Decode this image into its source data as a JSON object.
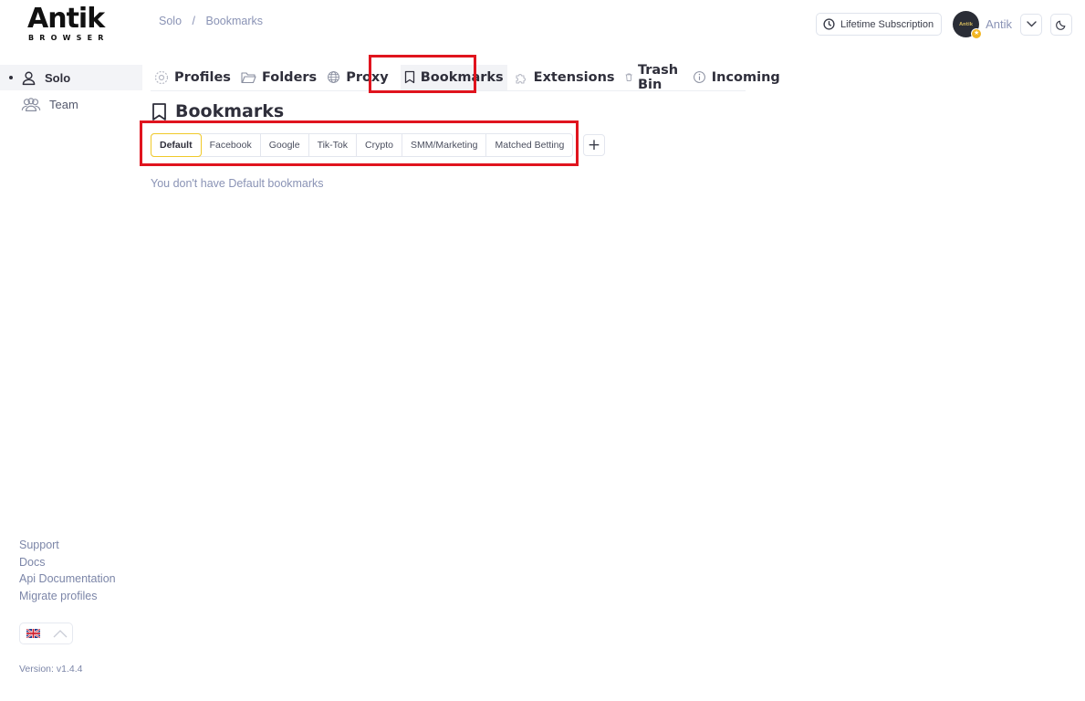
{
  "logo": {
    "main": "Antik",
    "sub": "BROWSER"
  },
  "breadcrumb": {
    "items": [
      "Solo",
      "Bookmarks"
    ],
    "separator": "/"
  },
  "header": {
    "subscription_label": "Lifetime Subscription",
    "username": "Antik",
    "avatar_text": "Antik"
  },
  "sidebar": {
    "items": [
      {
        "label": "Solo",
        "icon": "user-icon",
        "active": true
      },
      {
        "label": "Team",
        "icon": "users-icon",
        "active": false
      }
    ],
    "links": [
      "Support",
      "Docs",
      "Api Documentation",
      "Migrate profiles"
    ],
    "language": "English (UK)",
    "version": "Version: v1.4.4"
  },
  "nav": {
    "tabs": [
      {
        "label": "Profiles",
        "icon": "fingerprint-icon"
      },
      {
        "label": "Folders",
        "icon": "folder-icon"
      },
      {
        "label": "Proxy",
        "icon": "globe-icon"
      },
      {
        "label": "Bookmarks",
        "icon": "bookmark-icon",
        "active": true
      },
      {
        "label": "Extensions",
        "icon": "puzzle-icon"
      },
      {
        "label": "Trash Bin",
        "icon": "trash-icon"
      },
      {
        "label": "Incoming",
        "icon": "info-icon"
      }
    ]
  },
  "page": {
    "title": "Bookmarks",
    "categories": [
      "Default",
      "Facebook",
      "Google",
      "Tik-Tok",
      "Crypto",
      "SMM/Marketing",
      "Matched Betting"
    ],
    "active_category": "Default",
    "add_label": "+",
    "empty_message": "You don't have Default bookmarks"
  },
  "colors": {
    "highlight": "#e0141e",
    "active_tab_border": "#f0c929",
    "muted_text": "#8a93b5",
    "badge": "#f2b521"
  }
}
